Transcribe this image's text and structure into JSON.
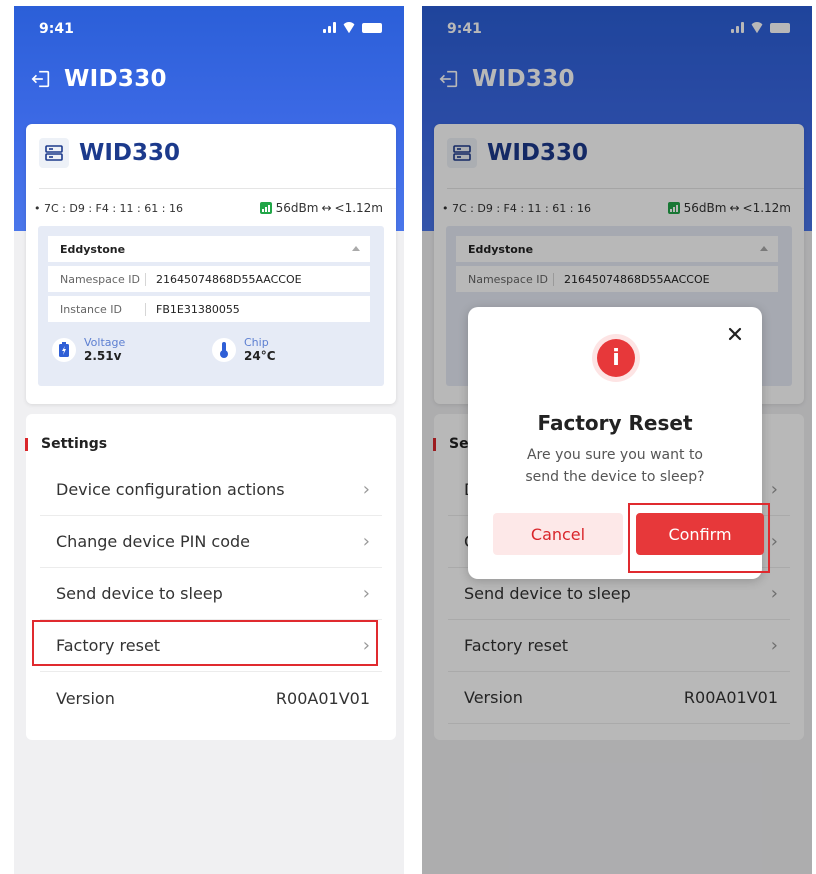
{
  "status_bar": {
    "time": "9:41"
  },
  "app_bar": {
    "title": "WID330"
  },
  "device": {
    "name": "WID330",
    "mac": "• 7C : D9 : F4 : 11 : 61 : 16",
    "rssi": "56dBm",
    "distance_arrow": "↔",
    "distance": "<1.12m",
    "frame_type": "Eddystone",
    "namespace_label": "Namespace ID",
    "namespace_value": "21645074868D55AACCOE",
    "instance_label": "Instance ID",
    "instance_value": "FB1E31380055",
    "voltage_label": "Voltage",
    "voltage_value": "2.51v",
    "chip_label": "Chip",
    "chip_value": "24°C"
  },
  "settings": {
    "title": "Settings",
    "items": [
      {
        "label": "Device configuration actions",
        "chevron": "›"
      },
      {
        "label": "Change device PIN code",
        "chevron": "›"
      },
      {
        "label": "Send device to sleep",
        "chevron": "›"
      },
      {
        "label": "Factory reset",
        "chevron": "›"
      }
    ],
    "version_label": "Version",
    "version_value": "R00A01V01"
  },
  "modal": {
    "alert_glyph": "i",
    "title": "Factory Reset",
    "message": "Are you sure you want to send the device to sleep?",
    "cancel_label": "Cancel",
    "confirm_label": "Confirm"
  },
  "colors": {
    "header_blue": "#3d6ae6",
    "accent_red": "#e7383a",
    "title_navy": "#1c3a8c",
    "rssi_green": "#22a648"
  }
}
